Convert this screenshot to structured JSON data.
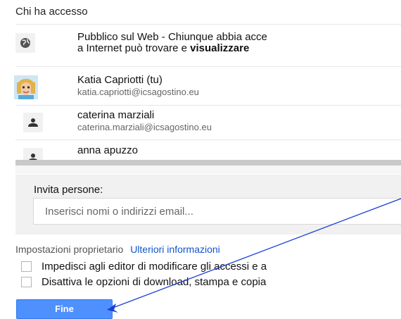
{
  "header": {
    "title": "Chi ha accesso"
  },
  "access_list": {
    "public": {
      "line1": "Pubblico sul Web - Chiunque abbia acce",
      "line2_prefix": "a Internet può trovare e ",
      "line2_bold": "visualizzare",
      "icon": "globe-icon"
    },
    "users": [
      {
        "name": "Katia Capriotti (tu)",
        "email": "katia.capriotti@icsagostino.eu",
        "icon": "avatar"
      },
      {
        "name": "caterina marziali",
        "email": "caterina.marziali@icsagostino.eu",
        "icon": "person-icon"
      },
      {
        "name": "anna apuzzo",
        "email": "",
        "icon": "person-icon"
      }
    ]
  },
  "invite": {
    "label": "Invita persone:",
    "placeholder": "Inserisci nomi o indirizzi email..."
  },
  "owner_settings": {
    "label": "Impostazioni proprietario",
    "link": "Ulteriori informazioni",
    "options": [
      "Impedisci agli editor di modificare gli accessi e a",
      "Disattiva le opzioni di download, stampa e copia"
    ]
  },
  "actions": {
    "done_label": "Fine"
  },
  "colors": {
    "primary_button": "#4d90fe",
    "link": "#1155cc",
    "annotation_arrow": "#1a3fd6"
  }
}
